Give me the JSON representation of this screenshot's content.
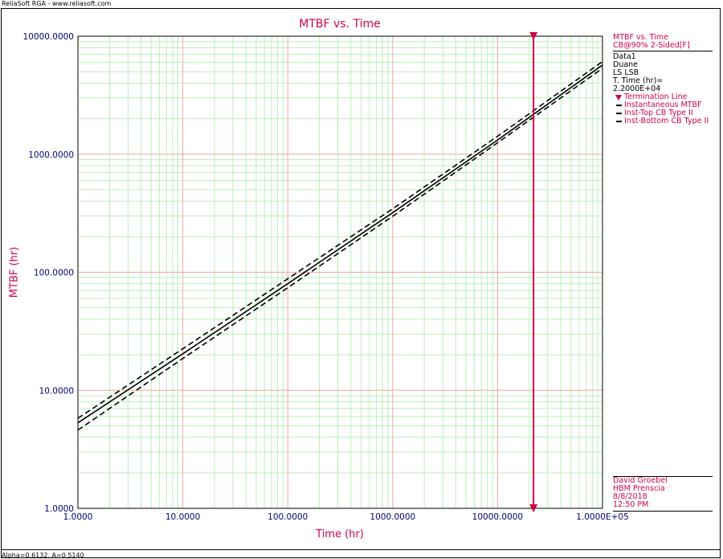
{
  "window": {
    "top_caption": "ReliaSoft RGA - www.reliasoft.com",
    "bottom_caption": "Alpha=0.6132, A=0.5140"
  },
  "legend": {
    "header1": "MTBF vs. Time",
    "header2": "CB@90% 2-Sided[F]",
    "data_name": "Data1",
    "model": "Duane",
    "method": "LS LSB",
    "t_time": "T. Time (hr)= 2.2000E+04",
    "items": [
      {
        "label": "Termination Line",
        "symbol": "triangle-icon",
        "color": "#d1004a"
      },
      {
        "label": "Instantaneous MTBF",
        "symbol": "solid-line-icon",
        "color": "#000000"
      },
      {
        "label": "Inst-Top CB Type II",
        "symbol": "dash-line-icon",
        "color": "#000000"
      },
      {
        "label": "Inst-Bottom CB Type II",
        "symbol": "dash-line-icon",
        "color": "#000000"
      }
    ]
  },
  "info": {
    "user": "David Groebel",
    "company": "HBM Prenscia",
    "date": "8/8/2018",
    "time": "12:50 PM"
  },
  "chart_data": {
    "type": "line",
    "title": "MTBF vs. Time",
    "xlabel": "Time (hr)",
    "ylabel": "MTBF (hr)",
    "xscale": "log",
    "yscale": "log",
    "xlim": [
      1,
      100000
    ],
    "ylim": [
      1,
      10000
    ],
    "x_tick_labels": [
      "1.0000",
      "10.0000",
      "100.0000",
      "1000.0000",
      "10000.0000",
      "1.0000E+05"
    ],
    "y_tick_labels": [
      "1.0000",
      "10.0000",
      "100.0000",
      "1000.0000",
      "10000.0000"
    ],
    "grid": true,
    "legend_position": "right",
    "termination_time": 22000,
    "series": [
      {
        "name": "Instantaneous MTBF",
        "style": "solid",
        "x": [
          1,
          10,
          100,
          1000,
          10000,
          100000
        ],
        "y": [
          5.3,
          20.4,
          80,
          320,
          1320,
          5700
        ]
      },
      {
        "name": "Inst-Top CB Type II",
        "style": "dashed",
        "x": [
          1,
          10,
          100,
          1000,
          10000,
          100000
        ],
        "y": [
          5.8,
          22.5,
          88,
          345,
          1420,
          6100
        ]
      },
      {
        "name": "Inst-Bottom CB Type II",
        "style": "dashed",
        "x": [
          1,
          10,
          100,
          1000,
          10000,
          100000
        ],
        "y": [
          4.6,
          18.6,
          74,
          298,
          1250,
          5350
        ]
      }
    ],
    "colors": {
      "major_grid": "#f4a4a4",
      "minor_grid": "#b8f0b8",
      "axis_text": "#00007a",
      "title": "#d1004a",
      "termination_line": "#d1004a",
      "series": "#000000"
    }
  }
}
